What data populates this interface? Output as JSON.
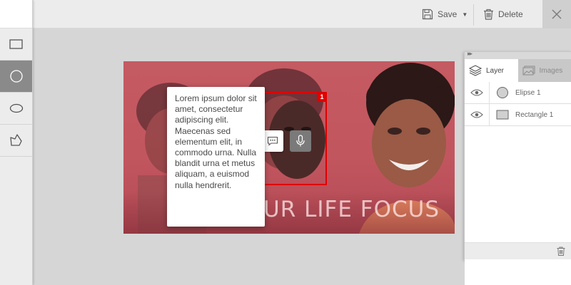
{
  "toolbar": {
    "save_label": "Save",
    "delete_label": "Delete",
    "icons": {
      "save": "floppy-disk-icon",
      "delete": "trash-icon",
      "close": "close-icon",
      "caret": "caret-down-icon"
    }
  },
  "sidebar": {
    "tools": [
      {
        "name": "rectangle-tool",
        "icon": "rectangle-icon",
        "active": false
      },
      {
        "name": "circle-tool",
        "icon": "circle-icon",
        "active": true
      },
      {
        "name": "ellipse-tool",
        "icon": "ellipse-icon",
        "active": false
      },
      {
        "name": "polygon-tool",
        "icon": "polygon-icon",
        "active": false
      }
    ]
  },
  "canvas": {
    "caption": "UR LIFE FOCUS",
    "selection_badge": "1"
  },
  "comment": {
    "text": "Lorem ipsum dolor sit amet, consectetur adipiscing elit. Maecenas sed elementum elit, in commodo urna. Nulla blandit urna et metus aliquam, a euismod nulla hendrerit."
  },
  "panel": {
    "tabs": [
      {
        "label": "Layer",
        "icon": "layers-icon",
        "active": true
      },
      {
        "label": "Images",
        "icon": "images-icon",
        "active": false
      }
    ],
    "layers": [
      {
        "label": "Elipse 1",
        "icon": "circle-icon"
      },
      {
        "label": "Rectangle 1",
        "icon": "rectangle-icon"
      }
    ]
  },
  "colors": {
    "selection": "#e00000",
    "active_tool": "#8a8a8a",
    "canvas_bg": "#c45a62"
  }
}
